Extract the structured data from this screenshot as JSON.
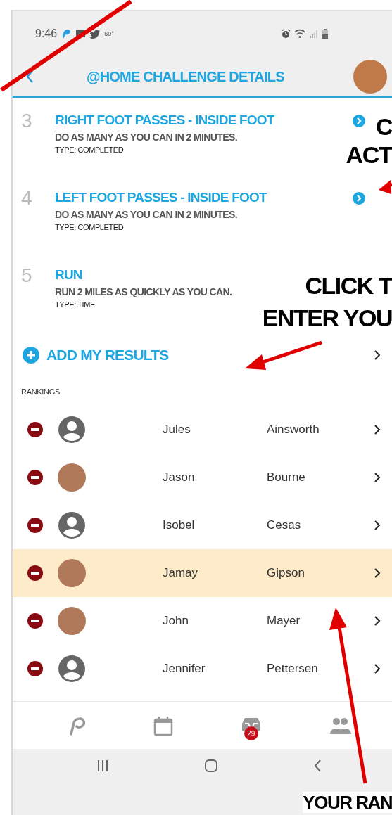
{
  "status_bar": {
    "time": "9:46",
    "temperature": "60°"
  },
  "header": {
    "title": "@HOME CHALLENGE DETAILS"
  },
  "steps": [
    {
      "number": "3",
      "title": "RIGHT FOOT PASSES - INSIDE FOOT",
      "description": "DO AS MANY AS YOU CAN IN 2 MINUTES.",
      "type": "TYPE: COMPLETED",
      "link": true
    },
    {
      "number": "4",
      "title": "LEFT FOOT PASSES - INSIDE FOOT",
      "description": "DO AS MANY AS YOU CAN IN 2 MINUTES.",
      "type": "TYPE: COMPLETED",
      "link": true
    },
    {
      "number": "5",
      "title": "RUN",
      "description": "RUN 2 MILES AS QUICKLY AS YOU CAN.",
      "type": "TYPE: TIME",
      "link": false
    }
  ],
  "add_results": {
    "label": "ADD MY RESULTS"
  },
  "rankings": {
    "label": "RANKINGS",
    "rows": [
      {
        "first_name": "Jules",
        "last_name": "Ainsworth",
        "kind": "icon",
        "selected": false
      },
      {
        "first_name": "Jason",
        "last_name": "Bourne",
        "kind": "photo",
        "selected": false
      },
      {
        "first_name": "Isobel",
        "last_name": "Cesas",
        "kind": "icon",
        "selected": false
      },
      {
        "first_name": "Jamay",
        "last_name": "Gipson",
        "kind": "photo",
        "selected": true
      },
      {
        "first_name": "John",
        "last_name": "Mayer",
        "kind": "photo",
        "selected": false
      },
      {
        "first_name": "Jennifer",
        "last_name": "Pettersen",
        "kind": "icon",
        "selected": false
      }
    ]
  },
  "bottom_nav": {
    "badge": "29"
  },
  "annotations": [
    {
      "kind": "label",
      "text": "C"
    },
    {
      "kind": "label",
      "text": "ACT"
    },
    {
      "kind": "label",
      "text": "CLICK T"
    },
    {
      "kind": "label",
      "text": "ENTER YOU"
    },
    {
      "kind": "label",
      "text": "YOUR RAN"
    }
  ]
}
